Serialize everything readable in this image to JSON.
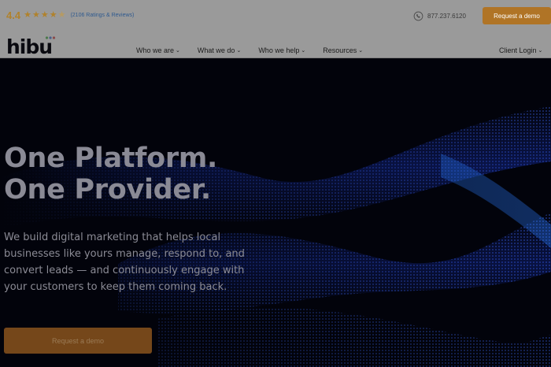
{
  "topbar": {
    "rating_value": "4.4",
    "stars": [
      "★",
      "★",
      "★",
      "★",
      "★"
    ],
    "ratings_link": "(2106 Ratings & Reviews)",
    "phone": "877.237.6120",
    "phone_icon": "phone-icon",
    "cta": "Request a demo"
  },
  "nav": {
    "logo": "hibu",
    "items": [
      {
        "label": "Who we are"
      },
      {
        "label": "What we do"
      },
      {
        "label": "Who we help"
      },
      {
        "label": "Resources"
      }
    ],
    "chevron": "⌄",
    "client_login": "Client Login"
  },
  "hero": {
    "headline_line1": "One Platform.",
    "headline_line2": "One Provider.",
    "subtext": "We build digital marketing that helps local businesses like yours manage, respond to, and convert leads — and continuously engage with your customers to keep them coming back.",
    "cta": "Request a demo"
  },
  "colors": {
    "accent": "#b07426",
    "topbar_bg": "#9a9a9a",
    "hero_bg": "#02030b"
  }
}
